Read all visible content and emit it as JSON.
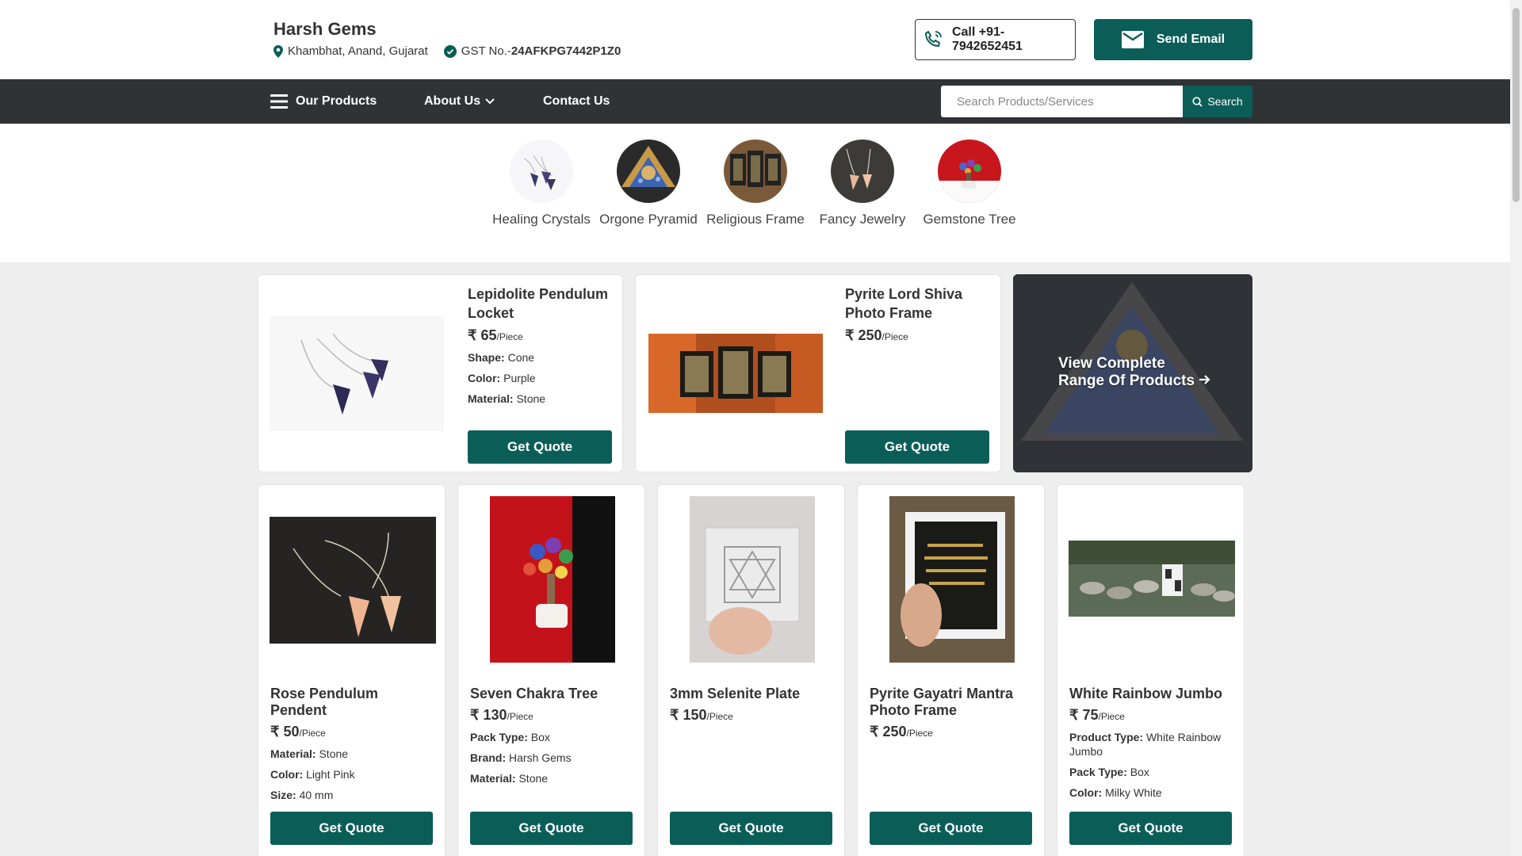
{
  "header": {
    "company": "Harsh Gems",
    "location": "Khambhat, Anand, Gujarat",
    "gst_label": "GST No.-",
    "gst_number": "24AFKPG7442P1Z0",
    "call_label": "Call +91-7942652451",
    "email_label": "Send Email"
  },
  "nav": {
    "products": "Our Products",
    "about": "About Us",
    "contact": "Contact Us",
    "search_placeholder": "Search Products/Services",
    "search_button": "Search"
  },
  "categories": [
    {
      "label": "Healing Crystals"
    },
    {
      "label": "Orgone Pyramid"
    },
    {
      "label": "Religious Frame"
    },
    {
      "label": "Fancy Jewelry"
    },
    {
      "label": "Gemstone Tree"
    }
  ],
  "featured": [
    {
      "title": "Lepidolite Pendulum Locket",
      "price": "₹ 65",
      "unit": "/Piece",
      "attrs": [
        {
          "k": "Shape:",
          "v": "Cone"
        },
        {
          "k": "Color:",
          "v": "Purple"
        },
        {
          "k": "Material:",
          "v": "Stone"
        }
      ],
      "button": "Get Quote"
    },
    {
      "title": "Pyrite Lord Shiva Photo Frame",
      "price": "₹ 250",
      "unit": "/Piece",
      "button": "Get Quote"
    }
  ],
  "view_all": {
    "line1": "View Complete",
    "line2": "Range Of Products"
  },
  "products": [
    {
      "title": "Rose Pendulum Pendent",
      "price": "₹ 50",
      "unit": "/Piece",
      "attrs": [
        {
          "k": "Material:",
          "v": "Stone"
        },
        {
          "k": "Color:",
          "v": "Light Pink"
        },
        {
          "k": "Size:",
          "v": "40 mm"
        }
      ],
      "button": "Get Quote"
    },
    {
      "title": "Seven Chakra Tree",
      "price": "₹ 130",
      "unit": "/Piece",
      "attrs": [
        {
          "k": "Pack Type:",
          "v": "Box"
        },
        {
          "k": "Brand:",
          "v": "Harsh Gems"
        },
        {
          "k": "Material:",
          "v": "Stone"
        }
      ],
      "button": "Get Quote"
    },
    {
      "title": "3mm Selenite Plate",
      "price": "₹ 150",
      "unit": "/Piece",
      "attrs": [],
      "button": "Get Quote"
    },
    {
      "title": "Pyrite Gayatri Mantra Photo Frame",
      "price": "₹ 250",
      "unit": "/Piece",
      "attrs": [],
      "button": "Get Quote"
    },
    {
      "title": "White Rainbow Jumbo",
      "price": "₹ 75",
      "unit": "/Piece",
      "attrs": [
        {
          "k": "Product Type:",
          "v": "White Rainbow Jumbo"
        },
        {
          "k": "Pack Type:",
          "v": "Box"
        },
        {
          "k": "Color:",
          "v": "Milky White"
        }
      ],
      "button": "Get Quote"
    }
  ],
  "colors": {
    "brand": "#0b5e58",
    "nav": "#2f3336"
  }
}
